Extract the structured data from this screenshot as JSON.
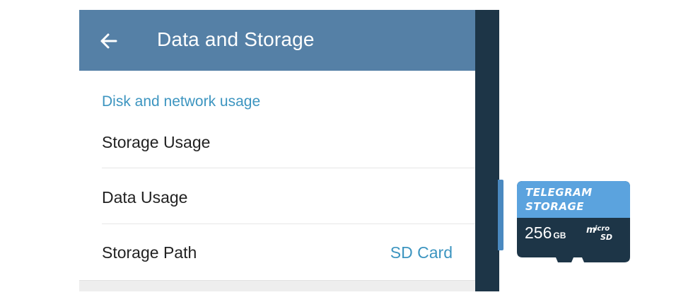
{
  "app_bar": {
    "title": "Data and Storage",
    "back_icon": "arrow-left-icon",
    "color": "#5580a6"
  },
  "section": {
    "header": "Disk and network usage",
    "accent_color": "#3d95c0"
  },
  "rows": [
    {
      "label": "Storage Usage",
      "value": ""
    },
    {
      "label": "Data Usage",
      "value": ""
    },
    {
      "label": "Storage Path",
      "value": "SD Card"
    }
  ],
  "sd_card": {
    "brand_line1": "TELEGRAM",
    "brand_line2": "STORAGE",
    "capacity": "256",
    "capacity_unit": "GB",
    "format": "micro SD",
    "top_color": "#5ba3de",
    "body_color": "#1d3547"
  }
}
